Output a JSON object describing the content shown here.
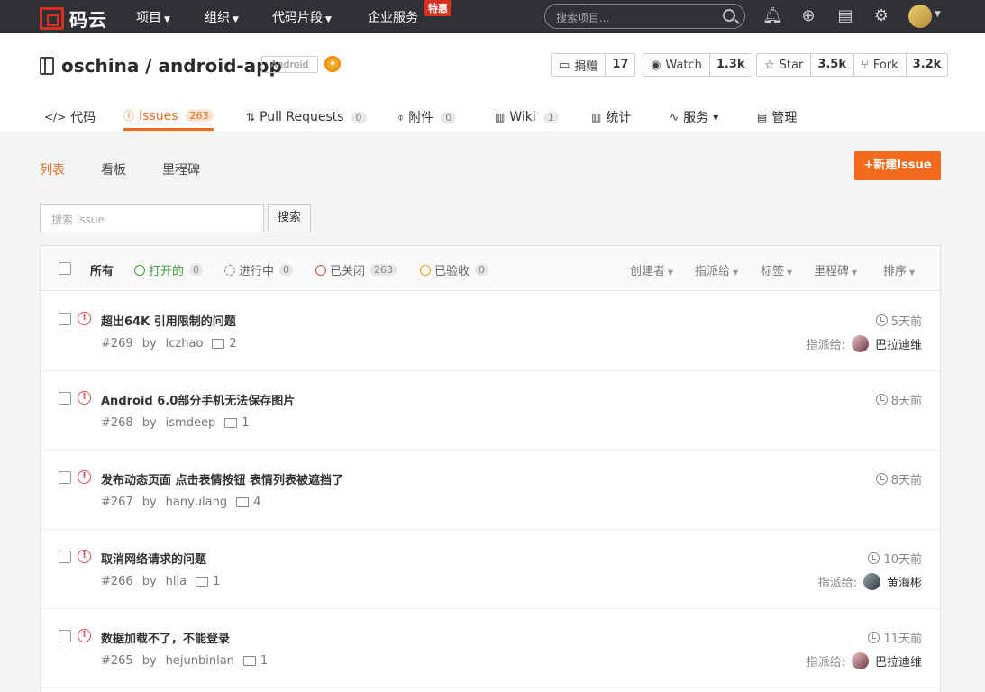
{
  "topnav": {
    "logo_text": "码云",
    "items": [
      {
        "label": "项目",
        "caret": true
      },
      {
        "label": "组织",
        "caret": true
      },
      {
        "label": "代码片段",
        "caret": true
      },
      {
        "label": "企业服务",
        "caret": false
      }
    ],
    "promo_badge": "特惠",
    "search_placeholder": "搜索项目...",
    "icons": [
      "bell-icon",
      "plus-circle-icon",
      "document-settings-icon",
      "gear-icon"
    ]
  },
  "repo": {
    "owner_repo": "oschina / android-app",
    "language": "Android",
    "donate": {
      "label": "捐赠",
      "count": "17"
    },
    "watch": {
      "label": "Watch",
      "count": "1.3k"
    },
    "star": {
      "label": "Star",
      "count": "3.5k"
    },
    "fork": {
      "label": "Fork",
      "count": "3.2k"
    }
  },
  "tabs": [
    {
      "label": "代码",
      "count": null,
      "icon": "code-icon"
    },
    {
      "label": "Issues",
      "count": "263",
      "icon": "issue-icon",
      "active": true
    },
    {
      "label": "Pull Requests",
      "count": "0",
      "icon": "pull-request-icon"
    },
    {
      "label": "附件",
      "count": "0",
      "icon": "attachment-icon"
    },
    {
      "label": "Wiki",
      "count": "1",
      "icon": "wiki-icon"
    },
    {
      "label": "统计",
      "count": null,
      "icon": "chart-icon"
    },
    {
      "label": "服务",
      "count": null,
      "icon": "pulse-icon"
    },
    {
      "label": "管理",
      "count": null,
      "icon": "manage-icon"
    }
  ],
  "subtabs": [
    {
      "label": "列表",
      "active": true
    },
    {
      "label": "看板"
    },
    {
      "label": "里程碑"
    }
  ],
  "new_issue_label": "+新建Issue",
  "issue_search": {
    "placeholder": "搜索 Issue",
    "button": "搜索"
  },
  "filters": {
    "all": "所有",
    "open": {
      "label": "打开的",
      "count": "0"
    },
    "progress": {
      "label": "进行中",
      "count": "0"
    },
    "closed": {
      "label": "已关闭",
      "count": "263"
    },
    "accepted": {
      "label": "已验收",
      "count": "0"
    }
  },
  "dropdowns": [
    "创建者",
    "指派给",
    "标签",
    "里程碑",
    "排序"
  ],
  "assign_label": "指派给:",
  "by_label": "by",
  "issues": [
    {
      "title": "超出64K 引用限制的问题",
      "number": "#269",
      "author": "lczhao",
      "comments": "2",
      "time": "5天前",
      "assignee": "巴拉迪维"
    },
    {
      "title": "Android 6.0部分手机无法保存图片",
      "number": "#268",
      "author": "ismdeep",
      "comments": "1",
      "time": "8天前",
      "assignee": null
    },
    {
      "title": "发布动态页面 点击表情按钮 表情列表被遮挡了",
      "number": "#267",
      "author": "hanyulang",
      "comments": "4",
      "time": "8天前",
      "assignee": null
    },
    {
      "title": "取消网络请求的问题",
      "number": "#266",
      "author": "hlla",
      "comments": "1",
      "time": "10天前",
      "assignee": "黄海彬"
    },
    {
      "title": "数据加载不了，不能登录",
      "number": "#265",
      "author": "hejunbinlan",
      "comments": "1",
      "time": "11天前",
      "assignee": "巴拉迪维"
    }
  ]
}
